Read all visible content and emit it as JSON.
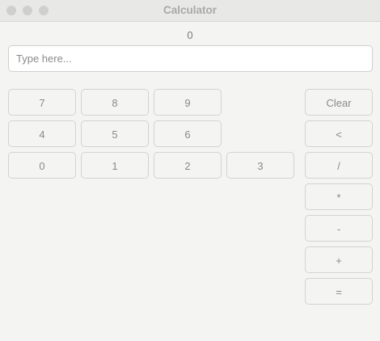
{
  "window": {
    "title": "Calculator"
  },
  "display": {
    "value": "0"
  },
  "input": {
    "placeholder": "Type here...",
    "value": ""
  },
  "buttons": {
    "seven": "7",
    "eight": "8",
    "nine": "9",
    "four": "4",
    "five": "5",
    "six": "6",
    "zero": "0",
    "one": "1",
    "two": "2",
    "three": "3",
    "clear": "Clear",
    "backspace": "<",
    "divide": "/",
    "multiply": "*",
    "subtract": "-",
    "add": "+",
    "equals": "="
  }
}
